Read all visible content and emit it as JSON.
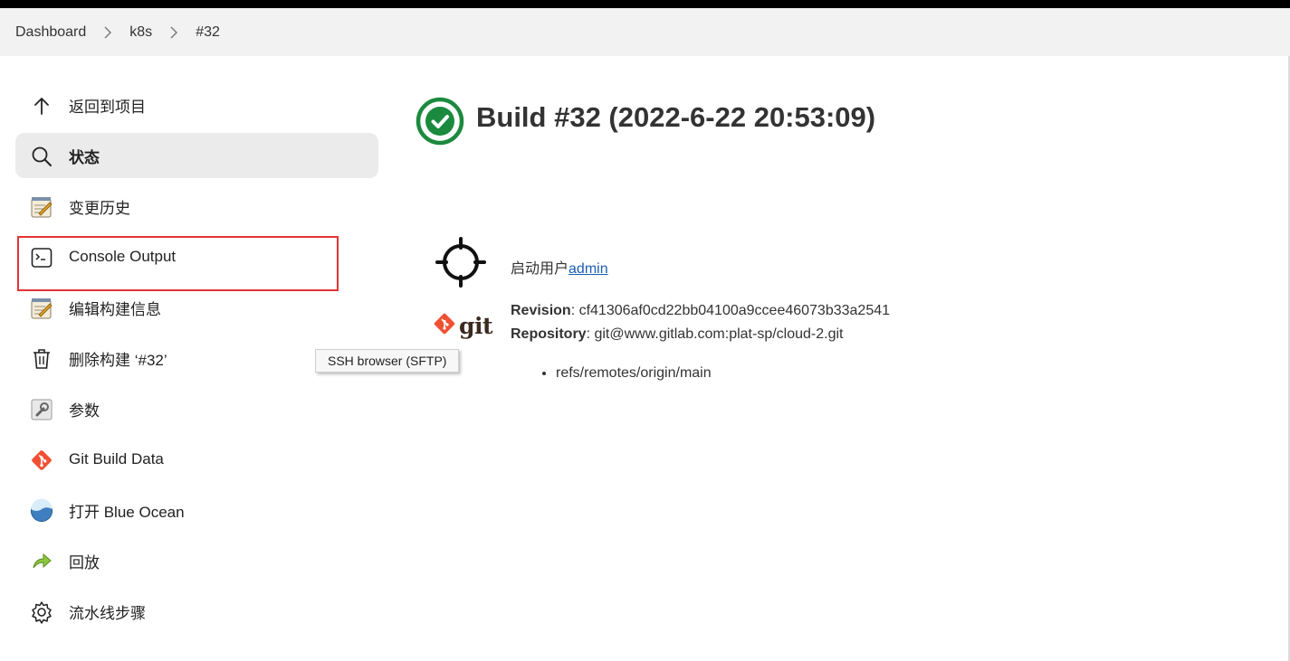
{
  "breadcrumb": {
    "items": [
      "Dashboard",
      "k8s",
      "#32"
    ]
  },
  "sidebar": {
    "items": [
      {
        "label": "返回到项目",
        "icon": "arrow-up-icon"
      },
      {
        "label": "状态",
        "icon": "search-icon",
        "active": true
      },
      {
        "label": "变更历史",
        "icon": "notepad-icon"
      },
      {
        "label": "Console Output",
        "icon": "terminal-icon"
      },
      {
        "label": "编辑构建信息",
        "icon": "notepad-icon"
      },
      {
        "label": "删除构建 ‘#32’",
        "icon": "trash-icon"
      },
      {
        "label": "参数",
        "icon": "wrench-icon"
      },
      {
        "label": "Git Build Data",
        "icon": "git-diamond-icon"
      },
      {
        "label": "打开 Blue Ocean",
        "icon": "blue-ocean-icon"
      },
      {
        "label": "回放",
        "icon": "replay-icon"
      },
      {
        "label": "流水线步骤",
        "icon": "gear-icon"
      }
    ]
  },
  "tooltip": {
    "text": "SSH browser (SFTP)"
  },
  "build": {
    "title": "Build #32 (2022-6-22 20:53:09)",
    "status_icon": "success-check-icon",
    "started_by_prefix": "启动用户",
    "started_by_user": "admin",
    "revision_key": "Revision",
    "revision_value": ": cf41306af0cd22bb04100a9ccee46073b33a2541",
    "repository_key": "Repository",
    "repository_value": ": git@www.gitlab.com:plat-sp/cloud-2.git",
    "git_logo_text": "git",
    "branches": [
      "refs/remotes/origin/main"
    ]
  },
  "colors": {
    "success": "#1b8a3e",
    "link": "#1a5fb4",
    "highlight_border": "#e03535",
    "git_orange": "#f05033"
  }
}
